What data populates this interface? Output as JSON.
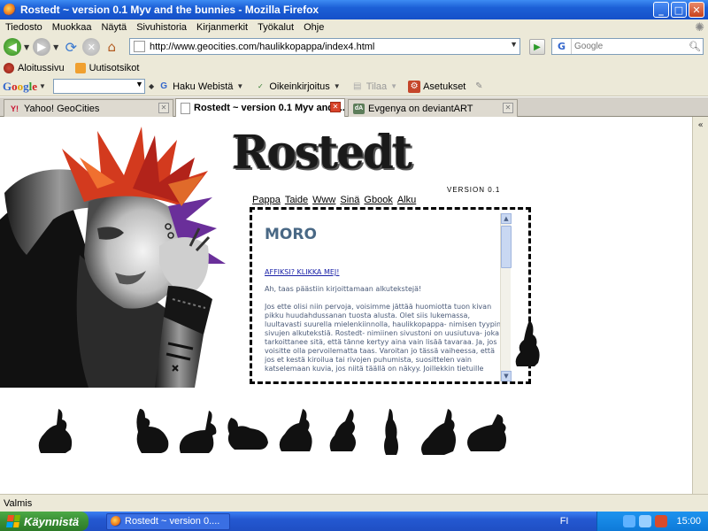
{
  "window": {
    "title": "Rostedt ~ version 0.1 Myv and the bunnies - Mozilla Firefox",
    "buttons": {
      "minimize": "_",
      "maximize": "□",
      "close": "✕"
    }
  },
  "menu": [
    "Tiedosto",
    "Muokkaa",
    "Näytä",
    "Sivuhistoria",
    "Kirjanmerkit",
    "Työkalut",
    "Ohje"
  ],
  "nav": {
    "url": "http://www.geocities.com/haulikkopappa/index4.html",
    "search_placeholder": "Google"
  },
  "bookmarks": [
    "Aloitussivu",
    "Uutisotsikot"
  ],
  "google_toolbar": {
    "logo": [
      "G",
      "o",
      "o",
      "g",
      "l",
      "e"
    ],
    "items": [
      "Haku Webistä",
      "Oikeinkirjoitus",
      "Tilaa",
      "Asetukset"
    ]
  },
  "tabs": [
    {
      "label": "Yahoo! GeoCities",
      "icon": "Y!"
    },
    {
      "label": "Rostedt ~ version 0.1 Myv and t...",
      "icon": "page"
    },
    {
      "label": "Evgenya on deviantART",
      "icon": "dA"
    }
  ],
  "site": {
    "logo": "Rostedt",
    "version": "VERSION 0.1",
    "nav": [
      "Pappa",
      "Taide",
      "Www",
      "Sinä",
      "Gbook",
      "Alku"
    ],
    "heading": "MORO",
    "affiksi_link": "AFFIKSI? KLIKKA MEJ!",
    "intro": "Ah, taas päästiin kirjoittamaan alkutekstejä!",
    "body": "Jos ette olisi niin pervoja, voisimme jättää huomiotta tuon kivan pikku huudahdussanan tuosta alusta. Olet siis lukemassa, luultavasti suurella mielenkiinnolla, haulikkopappa- nimisen tyypin sivujen alkutekstiä. Rostedt- nimiinen sivustoni on uusiutuva- joka tarkoittanee sitä, että tänne kertyy aina vain lisää tavaraa. Ja, jos voisitte olla pervoilematta taas. Varoitan jo tässä vaiheessa, että jos et kestä kiroilua tai rivojen puhumista, suosittelen vain katselemaan kuvia, jos niitä täällä on näkyy. Joillekkin tietuille"
  },
  "status": "Valmis",
  "taskbar": {
    "start": "Käynnistä",
    "window_item": "Rostedt ~ version 0....",
    "lang": "FI",
    "clock": "15:00"
  },
  "colors": {
    "heading": "#496885",
    "body_text": "#4a5a78",
    "link": "#1b22a8",
    "titlebar": "#1c5fd6"
  }
}
